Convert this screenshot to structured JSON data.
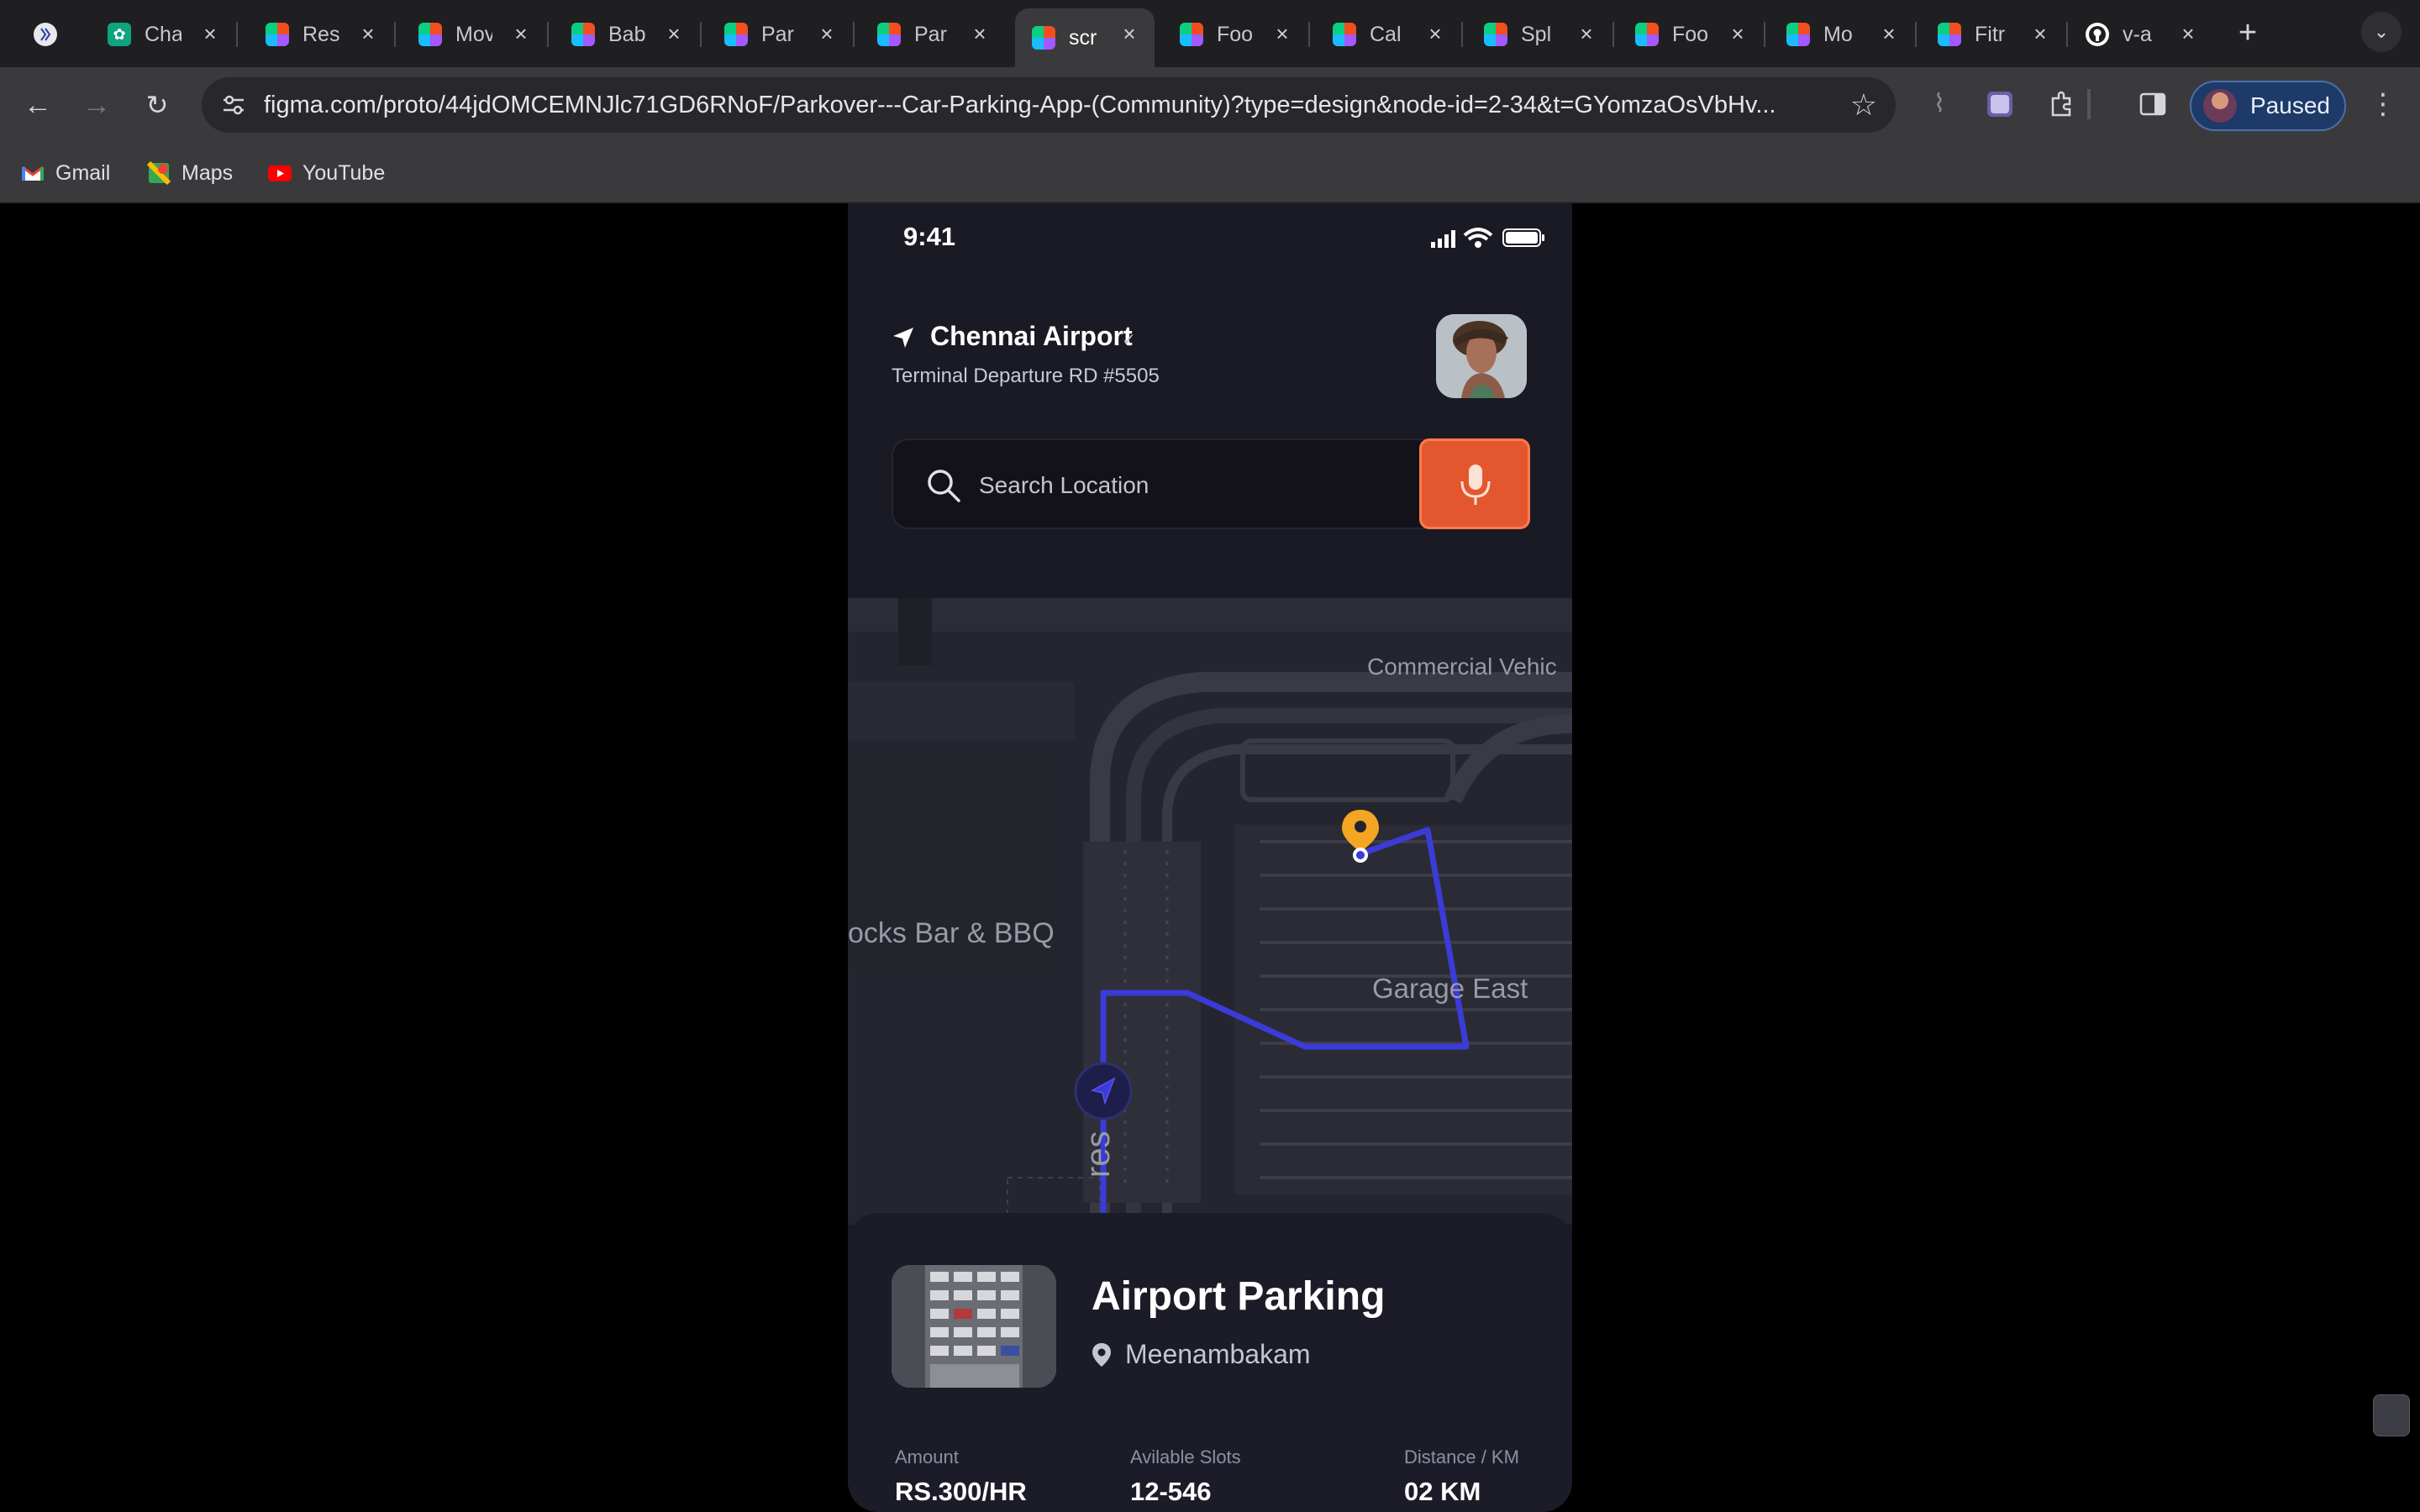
{
  "browser": {
    "tabs": [
      {
        "label": "",
        "favicon": "perplexity-icon",
        "close": ""
      },
      {
        "label": "Cha",
        "favicon": "chatgpt-icon",
        "close": "×"
      },
      {
        "label": "Res",
        "favicon": "figma-icon",
        "close": "×"
      },
      {
        "label": "Mov",
        "favicon": "figma-icon",
        "close": "×"
      },
      {
        "label": "Bab",
        "favicon": "figma-icon",
        "close": "×"
      },
      {
        "label": "Par",
        "favicon": "figma-icon",
        "close": "×"
      },
      {
        "label": "Par",
        "favicon": "figma-icon",
        "close": "×"
      },
      {
        "label": "scr",
        "favicon": "figma-icon",
        "close": "×",
        "active": true
      },
      {
        "label": "Foo",
        "favicon": "figma-icon",
        "close": "×"
      },
      {
        "label": "Cal",
        "favicon": "figma-icon",
        "close": "×"
      },
      {
        "label": "Spl",
        "favicon": "figma-icon",
        "close": "×"
      },
      {
        "label": "Foo",
        "favicon": "figma-icon",
        "close": "×"
      },
      {
        "label": "Mo",
        "favicon": "figma-icon",
        "close": "×"
      },
      {
        "label": "Fitr",
        "favicon": "figma-icon",
        "close": "×"
      },
      {
        "label": "v-a",
        "favicon": "github-icon",
        "close": "×"
      }
    ],
    "new_tab": "+",
    "url": "figma.com/proto/44jdOMCEMNJlc71GD6RNoF/Parkover---Car-Parking-App-(Community)?type=design&node-id=2-34&t=GYomzaOsVbHv...",
    "profile_label": "Paused",
    "bookmarks": [
      {
        "label": "Gmail",
        "icon": "gmail-icon"
      },
      {
        "label": "Maps",
        "icon": "maps-icon"
      },
      {
        "label": "YouTube",
        "icon": "youtube-icon"
      }
    ]
  },
  "app": {
    "status_time": "9:41",
    "location": {
      "title": "Chennai Airport",
      "subtitle": "Terminal Departure RD #5505"
    },
    "search": {
      "placeholder": "Search Location"
    },
    "map": {
      "labels": {
        "commercial": "Commercial Vehic",
        "bar": "ocks Bar & BBQ",
        "garage": "Garage East",
        "road": "res"
      }
    },
    "parking": {
      "title": "Airport Parking",
      "place": "Meenambakam",
      "stats": [
        {
          "label": "Amount",
          "value": "RS.300/HR"
        },
        {
          "label": "Avilable Slots",
          "value": "12-546"
        },
        {
          "label": "Distance / KM",
          "value": "02 KM"
        }
      ]
    },
    "colors": {
      "accent": "#e4572e",
      "route": "#3b3bd8",
      "pin": "#f4a524",
      "background": "#1a1a24"
    }
  }
}
